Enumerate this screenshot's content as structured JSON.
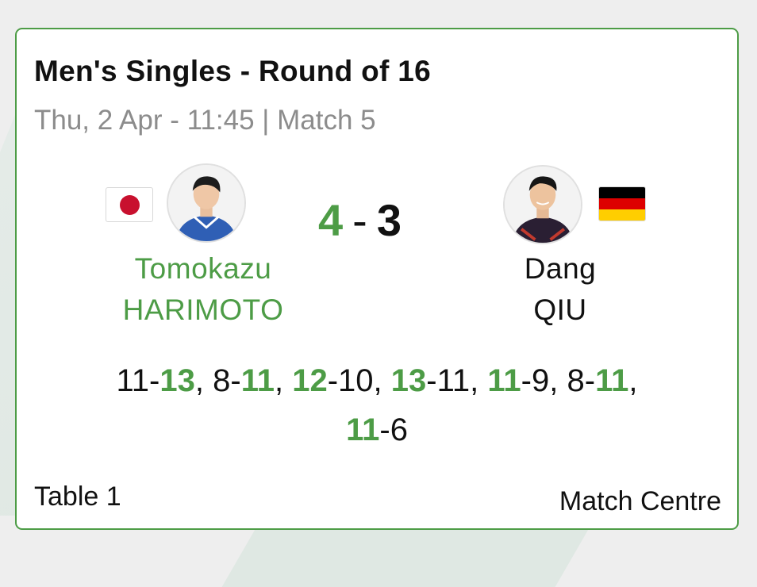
{
  "match": {
    "title": "Men's Singles - Round of 16",
    "subtitle": "Thu, 2 Apr - 11:45 | Match 5",
    "table": "Table 1",
    "match_centre_label": "Match Centre"
  },
  "player_left": {
    "first_name": "Tomokazu",
    "last_name": "HARIMOTO",
    "flag": "japan-flag-icon",
    "games_won": "4",
    "name_color": "#4d9c46"
  },
  "player_right": {
    "first_name": "Dang",
    "last_name": "QIU",
    "flag": "germany-flag-icon",
    "games_won": "3",
    "name_color": "#111111"
  },
  "score": {
    "left": "4",
    "separator": "-",
    "right": "3"
  },
  "games": [
    {
      "left": "11",
      "right": "13",
      "winner": "right"
    },
    {
      "left": "8",
      "right": "11",
      "winner": "right"
    },
    {
      "left": "12",
      "right": "10",
      "winner": "left"
    },
    {
      "left": "13",
      "right": "11",
      "winner": "left"
    },
    {
      "left": "11",
      "right": "9",
      "winner": "left"
    },
    {
      "left": "8",
      "right": "11",
      "winner": "right"
    },
    {
      "left": "11",
      "right": "6",
      "winner": "left"
    }
  ],
  "colors": {
    "accent": "#4d9c46",
    "border": "#4d9c46",
    "muted_text": "#8c8c8c",
    "japan_red": "#c8102e",
    "germany_black": "#000000",
    "germany_red": "#dd0000",
    "germany_gold": "#ffce00"
  }
}
